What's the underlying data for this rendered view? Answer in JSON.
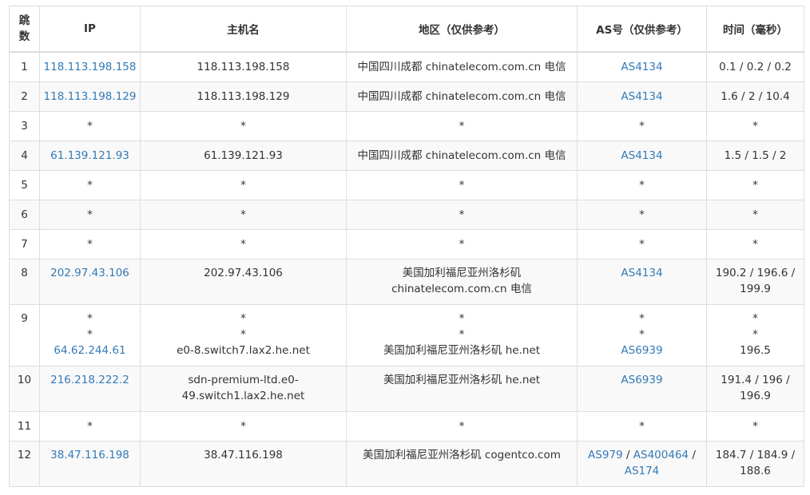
{
  "headers": {
    "hop": "跳数",
    "ip": "IP",
    "hostname": "主机名",
    "region": "地区（仅供参考）",
    "as": "AS号（仅供参考）",
    "time": "时间（毫秒）"
  },
  "rows": [
    {
      "hop": "1",
      "ip": "118.113.198.158",
      "host": "118.113.198.158",
      "region": "中国四川成都 chinatelecom.com.cn 电信",
      "as": "AS4134",
      "time": "0.1 / 0.2 / 0.2"
    },
    {
      "hop": "2",
      "ip": "118.113.198.129",
      "host": "118.113.198.129",
      "region": "中国四川成都 chinatelecom.com.cn 电信",
      "as": "AS4134",
      "time": "1.6 / 2 / 10.4"
    },
    {
      "hop": "3",
      "ip": "*",
      "host": "*",
      "region": "*",
      "as": "*",
      "time": "*"
    },
    {
      "hop": "4",
      "ip": "61.139.121.93",
      "host": "61.139.121.93",
      "region": "中国四川成都 chinatelecom.com.cn 电信",
      "as": "AS4134",
      "time": "1.5 / 1.5 / 2"
    },
    {
      "hop": "5",
      "ip": "*",
      "host": "*",
      "region": "*",
      "as": "*",
      "time": "*"
    },
    {
      "hop": "6",
      "ip": "*",
      "host": "*",
      "region": "*",
      "as": "*",
      "time": "*"
    },
    {
      "hop": "7",
      "ip": "*",
      "host": "*",
      "region": "*",
      "as": "*",
      "time": "*"
    },
    {
      "hop": "8",
      "ip": "202.97.43.106",
      "host": "202.97.43.106",
      "region_l1": "美国加利福尼亚州洛杉矶",
      "region_l2": "chinatelecom.com.cn 电信",
      "as": "AS4134",
      "time_l1": "190.2 / 196.6 /",
      "time_l2": "199.9"
    },
    {
      "hop": "9",
      "star": "*",
      "ip": "64.62.244.61",
      "host": "e0-8.switch7.lax2.he.net",
      "region": "美国加利福尼亚州洛杉矶 he.net",
      "as": "AS6939",
      "time": "196.5"
    },
    {
      "hop": "10",
      "ip": "216.218.222.2",
      "host_l1": "sdn-premium-ltd.e0-",
      "host_l2": "49.switch1.lax2.he.net",
      "region": "美国加利福尼亚州洛杉矶 he.net",
      "as": "AS6939",
      "time_l1": "191.4 / 196 /",
      "time_l2": "196.9"
    },
    {
      "hop": "11",
      "ip": "*",
      "host": "*",
      "region": "*",
      "as": "*",
      "time": "*"
    },
    {
      "hop": "12",
      "ip": "38.47.116.198",
      "host": "38.47.116.198",
      "region": "美国加利福尼亚州洛杉矶 cogentco.com",
      "as_a": "AS979",
      "as_sep1": " / ",
      "as_b": "AS400464",
      "as_sep2": " /",
      "as_c": "AS174",
      "time_l1": "184.7 / 184.9 /",
      "time_l2": "188.6"
    }
  ],
  "colors": {
    "link": "#337ab7",
    "text": "#333333",
    "border": "#dddddd",
    "stripe": "#f9f9f9"
  }
}
